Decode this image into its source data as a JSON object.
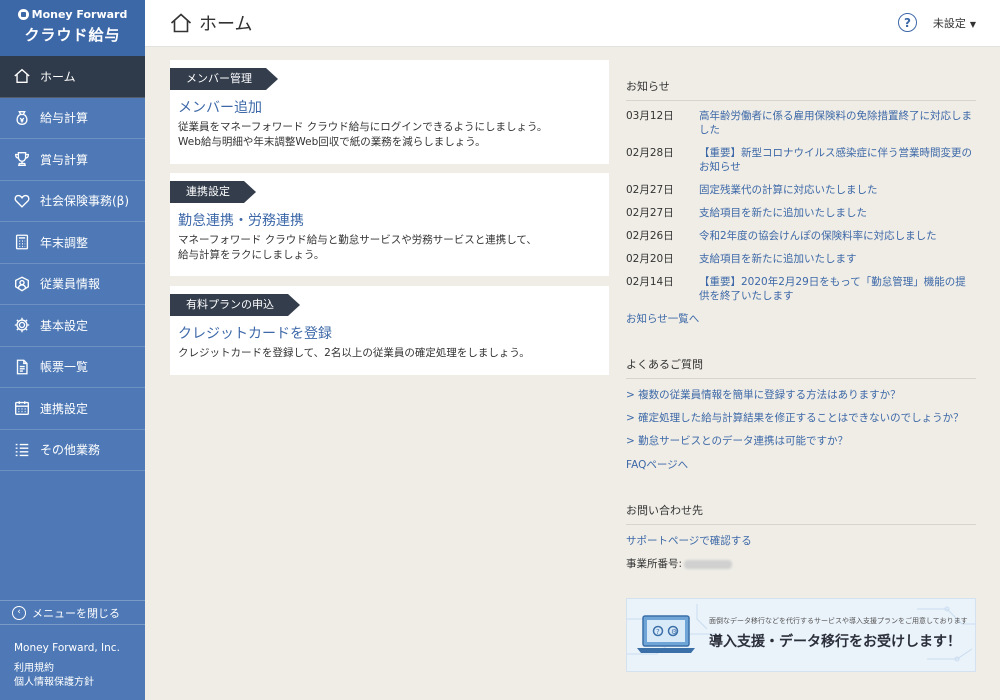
{
  "brand": {
    "top": "Money Forward",
    "sub": "クラウド給与"
  },
  "sidebar": {
    "items": [
      {
        "label": "ホーム",
        "icon": "home-icon"
      },
      {
        "label": "給与計算",
        "icon": "money-bag-icon"
      },
      {
        "label": "賞与計算",
        "icon": "trophy-icon"
      },
      {
        "label": "社会保険事務(β)",
        "icon": "heart-icon"
      },
      {
        "label": "年末調整",
        "icon": "calculator-icon"
      },
      {
        "label": "従業員情報",
        "icon": "employee-icon"
      },
      {
        "label": "基本設定",
        "icon": "gear-icon"
      },
      {
        "label": "帳票一覧",
        "icon": "document-icon"
      },
      {
        "label": "連携設定",
        "icon": "calendar-icon"
      },
      {
        "label": "その他業務",
        "icon": "list-icon"
      }
    ],
    "close_label": "メニューを閉じる",
    "company": "Money Forward, Inc.",
    "terms": "利用規約",
    "privacy": "個人情報保護方針"
  },
  "header": {
    "title": "ホーム",
    "help": "?",
    "user": "未設定"
  },
  "cards": [
    {
      "tag": "メンバー管理",
      "link": "メンバー追加",
      "desc1": "従業員をマネーフォワード クラウド給与にログインできるようにしましょう。",
      "desc2": "Web給与明細や年末調整Web回収で紙の業務を減らしましょう。"
    },
    {
      "tag": "連携設定",
      "link": "勤怠連携・労務連携",
      "desc1": "マネーフォワード クラウド給与と勤怠サービスや労務サービスと連携して、",
      "desc2": "給与計算をラクにしましょう。"
    },
    {
      "tag": "有料プランの申込",
      "link": "クレジットカードを登録",
      "desc1": "クレジットカードを登録して、2名以上の従業員の確定処理をしましょう。",
      "desc2": ""
    }
  ],
  "news": {
    "title": "お知らせ",
    "items": [
      {
        "date": "03月12日",
        "text": "高年齢労働者に係る雇用保険料の免除措置終了に対応しました"
      },
      {
        "date": "02月28日",
        "text": "【重要】新型コロナウイルス感染症に伴う営業時間変更のお知らせ"
      },
      {
        "date": "02月27日",
        "text": "固定残業代の計算に対応いたしました"
      },
      {
        "date": "02月27日",
        "text": "支給項目を新たに追加いたしました"
      },
      {
        "date": "02月26日",
        "text": "令和2年度の協会けんぽの保険料率に対応しました"
      },
      {
        "date": "02月20日",
        "text": "支給項目を新たに追加いたします"
      },
      {
        "date": "02月14日",
        "text": "【重要】2020年2月29日をもって「勤怠管理」機能の提供を終了いたします"
      }
    ],
    "more": "お知らせ一覧へ"
  },
  "faq": {
    "title": "よくあるご質問",
    "items": [
      "> 複数の従業員情報を簡単に登録する方法はありますか？",
      "> 確定処理した給与計算結果を修正することはできないのでしょうか？",
      "> 勤怠サービスとのデータ連携は可能ですか？"
    ],
    "more": "FAQページへ"
  },
  "contact": {
    "title": "お問い合わせ先",
    "support": "サポートページで確認する",
    "office_label": "事業所番号:"
  },
  "banner": {
    "small": "面倒なデータ移行などを代行するサービスや導入支援プランをご用意しております",
    "big": "導入支援・データ移行をお受けします！"
  }
}
